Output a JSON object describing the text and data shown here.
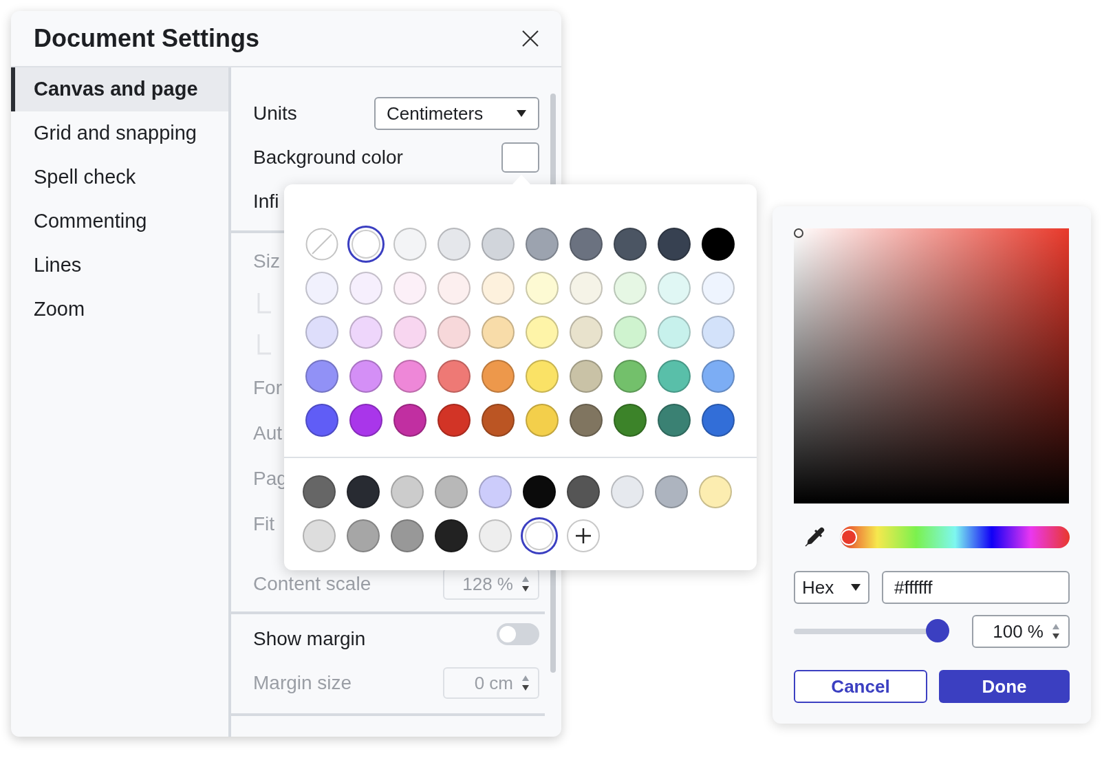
{
  "window": {
    "title": "Document Settings"
  },
  "sidebar": {
    "items": [
      {
        "label": "Canvas and page",
        "selected": true
      },
      {
        "label": "Grid and snapping",
        "selected": false
      },
      {
        "label": "Spell check",
        "selected": false
      },
      {
        "label": "Commenting",
        "selected": false
      },
      {
        "label": "Lines",
        "selected": false
      },
      {
        "label": "Zoom",
        "selected": false
      }
    ]
  },
  "units": {
    "label": "Units",
    "value": "Centimeters"
  },
  "background_color": {
    "label": "Background color",
    "color": "#ffffff"
  },
  "row_3": {
    "label": "Infi"
  },
  "section_2": [
    {
      "kind": "text",
      "label": "Siz",
      "disabled": true
    },
    {
      "kind": "sub"
    },
    {
      "kind": "sub"
    },
    {
      "kind": "text",
      "label": "For",
      "disabled": true
    },
    {
      "kind": "text",
      "label": "Aut",
      "disabled": true
    },
    {
      "kind": "text",
      "label": "Pag",
      "disabled": true
    },
    {
      "kind": "text",
      "label": "Fit",
      "disabled": true
    },
    {
      "kind": "number",
      "label": "Content scale",
      "value": "128 %",
      "disabled": true
    }
  ],
  "show_margin": {
    "label": "Show margin",
    "on": false
  },
  "margin_size": {
    "label": "Margin size",
    "value": "0 cm",
    "disabled": true
  },
  "swatches": [
    {
      "kind": "none",
      "selected": false
    },
    {
      "kind": "color",
      "color": "#ffffff",
      "selected": true
    },
    {
      "kind": "color",
      "color": "#f3f4f6",
      "selected": false
    },
    {
      "kind": "color",
      "color": "#e5e7eb",
      "selected": false
    },
    {
      "kind": "color",
      "color": "#d1d5db",
      "selected": false
    },
    {
      "kind": "color",
      "color": "#9ca3af",
      "selected": false
    },
    {
      "kind": "color",
      "color": "#6b7280",
      "selected": false
    },
    {
      "kind": "color",
      "color": "#4b5563",
      "selected": false
    },
    {
      "kind": "color",
      "color": "#374151",
      "selected": false
    },
    {
      "kind": "color",
      "color": "#000000",
      "selected": false
    },
    {
      "kind": "color",
      "color": "#f1f1fd",
      "selected": false
    },
    {
      "kind": "color",
      "color": "#f6effd",
      "selected": false
    },
    {
      "kind": "color",
      "color": "#fcf0f8",
      "selected": false
    },
    {
      "kind": "color",
      "color": "#fcefef",
      "selected": false
    },
    {
      "kind": "color",
      "color": "#fdf1dd",
      "selected": false
    },
    {
      "kind": "color",
      "color": "#fdfad3",
      "selected": false
    },
    {
      "kind": "color",
      "color": "#f5f3e7",
      "selected": false
    },
    {
      "kind": "color",
      "color": "#e6f7e4",
      "selected": false
    },
    {
      "kind": "color",
      "color": "#e0f7f4",
      "selected": false
    },
    {
      "kind": "color",
      "color": "#eef4fe",
      "selected": false
    },
    {
      "kind": "color",
      "color": "#dedefb",
      "selected": false
    },
    {
      "kind": "color",
      "color": "#eed6fb",
      "selected": false
    },
    {
      "kind": "color",
      "color": "#f8d6f0",
      "selected": false
    },
    {
      "kind": "color",
      "color": "#f7d8da",
      "selected": false
    },
    {
      "kind": "color",
      "color": "#f8dca9",
      "selected": false
    },
    {
      "kind": "color",
      "color": "#fef4a8",
      "selected": false
    },
    {
      "kind": "color",
      "color": "#e8e2cc",
      "selected": false
    },
    {
      "kind": "color",
      "color": "#cff3cf",
      "selected": false
    },
    {
      "kind": "color",
      "color": "#c7f1ec",
      "selected": false
    },
    {
      "kind": "color",
      "color": "#d3e2fa",
      "selected": false
    },
    {
      "kind": "color",
      "color": "#9191f6",
      "selected": false
    },
    {
      "kind": "color",
      "color": "#d48ff6",
      "selected": false
    },
    {
      "kind": "color",
      "color": "#ee87d8",
      "selected": false
    },
    {
      "kind": "color",
      "color": "#ee7975",
      "selected": false
    },
    {
      "kind": "color",
      "color": "#ed984b",
      "selected": false
    },
    {
      "kind": "color",
      "color": "#fae266",
      "selected": false
    },
    {
      "kind": "color",
      "color": "#c9c2a6",
      "selected": false
    },
    {
      "kind": "color",
      "color": "#73c06b",
      "selected": false
    },
    {
      "kind": "color",
      "color": "#59bfa9",
      "selected": false
    },
    {
      "kind": "color",
      "color": "#7cadf4",
      "selected": false
    },
    {
      "kind": "color",
      "color": "#605df6",
      "selected": false
    },
    {
      "kind": "color",
      "color": "#a936ea",
      "selected": false
    },
    {
      "kind": "color",
      "color": "#c12fa1",
      "selected": false
    },
    {
      "kind": "color",
      "color": "#d23426",
      "selected": false
    },
    {
      "kind": "color",
      "color": "#bb5523",
      "selected": false
    },
    {
      "kind": "color",
      "color": "#f3cf4b",
      "selected": false
    },
    {
      "kind": "color",
      "color": "#807560",
      "selected": false
    },
    {
      "kind": "color",
      "color": "#3c8329",
      "selected": false
    },
    {
      "kind": "color",
      "color": "#3a8173",
      "selected": false
    },
    {
      "kind": "color",
      "color": "#326ed8",
      "selected": false
    }
  ],
  "recent_swatches": [
    {
      "kind": "color",
      "color": "#666666",
      "selected": false
    },
    {
      "kind": "color",
      "color": "#282b32",
      "selected": false
    },
    {
      "kind": "color",
      "color": "#cccccc",
      "selected": false
    },
    {
      "kind": "color",
      "color": "#b8b8b8",
      "selected": false
    },
    {
      "kind": "color",
      "color": "#ccccfb",
      "selected": false
    },
    {
      "kind": "color",
      "color": "#0b0b0b",
      "selected": false
    },
    {
      "kind": "color",
      "color": "#555555",
      "selected": false
    },
    {
      "kind": "color",
      "color": "#e6e9ee",
      "selected": false
    },
    {
      "kind": "color",
      "color": "#adb4bf",
      "selected": false
    },
    {
      "kind": "color",
      "color": "#fcedb0",
      "selected": false
    },
    {
      "kind": "color",
      "color": "#dddddd",
      "selected": false
    },
    {
      "kind": "color",
      "color": "#a6a6a6",
      "selected": false
    },
    {
      "kind": "color",
      "color": "#989898",
      "selected": false
    },
    {
      "kind": "color",
      "color": "#222222",
      "selected": false
    },
    {
      "kind": "color",
      "color": "#eeeeee",
      "selected": false
    },
    {
      "kind": "color",
      "color": "#ffffff",
      "selected": true
    },
    {
      "kind": "add",
      "selected": false
    }
  ],
  "color_picker": {
    "hue_slider": {
      "level": 0
    },
    "format": "Hex",
    "hex": "#ffffff",
    "opacity": {
      "level": 1,
      "value": "100 %"
    },
    "buttons": [
      {
        "kind": "secondary",
        "label": "Cancel"
      },
      {
        "kind": "primary",
        "label": "Done"
      }
    ]
  }
}
